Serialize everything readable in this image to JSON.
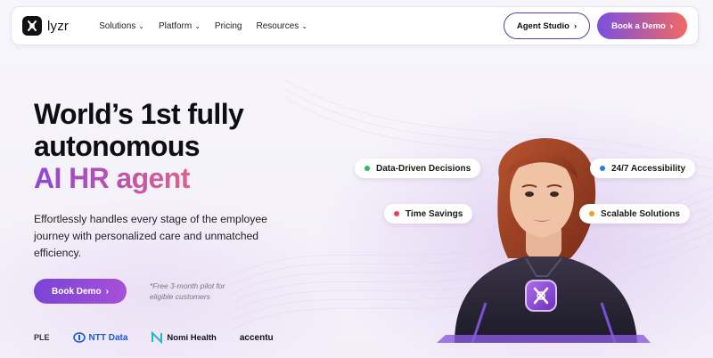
{
  "nav": {
    "brand": "lyzr",
    "menu": [
      {
        "label": "Solutions",
        "has_dropdown": true
      },
      {
        "label": "Platform",
        "has_dropdown": true
      },
      {
        "label": "Pricing",
        "has_dropdown": false
      },
      {
        "label": "Resources",
        "has_dropdown": true
      }
    ],
    "agent_studio_label": "Agent Studio",
    "book_demo_label": "Book a Demo"
  },
  "hero": {
    "title_line1": "World’s 1st fully",
    "title_line2": "autonomous",
    "title_accent": "AI HR agent",
    "subtitle": "Effortlessly handles every stage of the employee journey with personalized care and unmatched efficiency.",
    "cta_label": "Book Demo",
    "cta_note": "*Free 3-month pilot for eligible customers"
  },
  "pills": [
    {
      "label": "Data-Driven Decisions",
      "color": "#2dbe5a"
    },
    {
      "label": "24/7 Accessibility",
      "color": "#2f7be6"
    },
    {
      "label": "Time Savings",
      "color": "#ee3d5c"
    },
    {
      "label": "Scalable Solutions",
      "color": "#f0a020"
    }
  ],
  "clients": [
    {
      "name": "PLE"
    },
    {
      "name": "NTT Data"
    },
    {
      "name": "Nomi Health"
    },
    {
      "name": "accentu"
    }
  ],
  "colors": {
    "brand_purple": "#7b4fe0",
    "brand_coral": "#f06a63",
    "accent_text_start": "#8e46d8",
    "accent_text_end": "#e0608a"
  },
  "icons": {
    "logo": "lyzr-logo-icon",
    "chevron": "chevron-down-icon",
    "arrow": "chevron-right-icon"
  }
}
